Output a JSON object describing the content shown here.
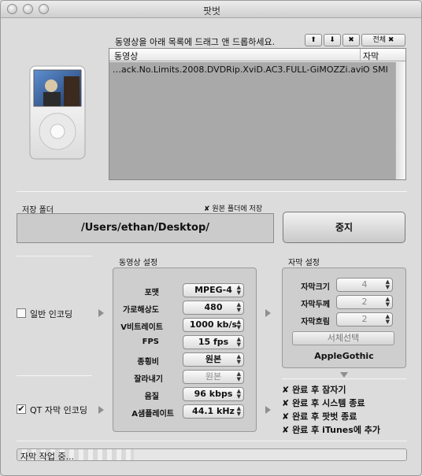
{
  "window": {
    "title": "팟벗"
  },
  "drop_hint": "동영상을 아래 목록에 드래그 앤 드롭하세요.",
  "list_controls": {
    "up": "⬆",
    "down": "⬇",
    "remove": "✖",
    "all": "전체 ✖"
  },
  "file_list": {
    "columns": [
      "동영상",
      "자막"
    ],
    "rows": [
      {
        "video": "…ack.No.Limits.2008.DVDRip.XviD.AC3.FULL-GiMOZZi.avi",
        "subtitle": "O SMI"
      }
    ]
  },
  "output": {
    "folder_label": "저장 폴더",
    "same_folder_check": "✘",
    "same_folder_label": "원본 폴더에 저장",
    "path": "/Users/ethan/Desktop/",
    "stop_button": "중지"
  },
  "encoding": {
    "normal_label": "일반 인코딩",
    "normal_checked": false,
    "qt_label": "QT 자막 인코딩",
    "qt_checked": true,
    "qt_check": "✔"
  },
  "video_settings": {
    "title": "동영상 설정",
    "fields": [
      {
        "label": "포맷",
        "value": "MPEG-4",
        "enabled": true
      },
      {
        "label": "가로해상도",
        "value": "480",
        "enabled": true
      },
      {
        "label": "V비트레이트",
        "value": "1000 kb/s",
        "enabled": true
      },
      {
        "label": "FPS",
        "value": "15 fps",
        "enabled": true
      },
      {
        "label": "종횡비",
        "value": "원본",
        "enabled": true
      },
      {
        "label": "잘라내기",
        "value": "원본",
        "enabled": false
      },
      {
        "label": "음질",
        "value": "96 kbps",
        "enabled": true
      },
      {
        "label": "A샘플레이트",
        "value": "44.1 kHz",
        "enabled": true
      }
    ]
  },
  "subtitle_settings": {
    "title": "자막 설정",
    "fields": [
      {
        "label": "자막크기",
        "value": "4"
      },
      {
        "label": "자막두께",
        "value": "2"
      },
      {
        "label": "자막흐림",
        "value": "2"
      }
    ],
    "font_button": "서체선택",
    "font_name": "AppleGothic"
  },
  "after_options": [
    {
      "mark": "✘",
      "label": "완료 후 잠자기"
    },
    {
      "mark": "✘",
      "label": "완료 후 시스템 종료"
    },
    {
      "mark": "✘",
      "label": "완료 후 팟벗 종료"
    },
    {
      "mark": "✘",
      "label": "완료 후 iTunes에 추가"
    }
  ],
  "status": {
    "text": "자막 작업 중...",
    "progress": 0.3
  },
  "colors": {
    "window_bg": "#dcdcdc",
    "list_bg": "#a9a9a9",
    "panel_bg": "#cecece"
  }
}
